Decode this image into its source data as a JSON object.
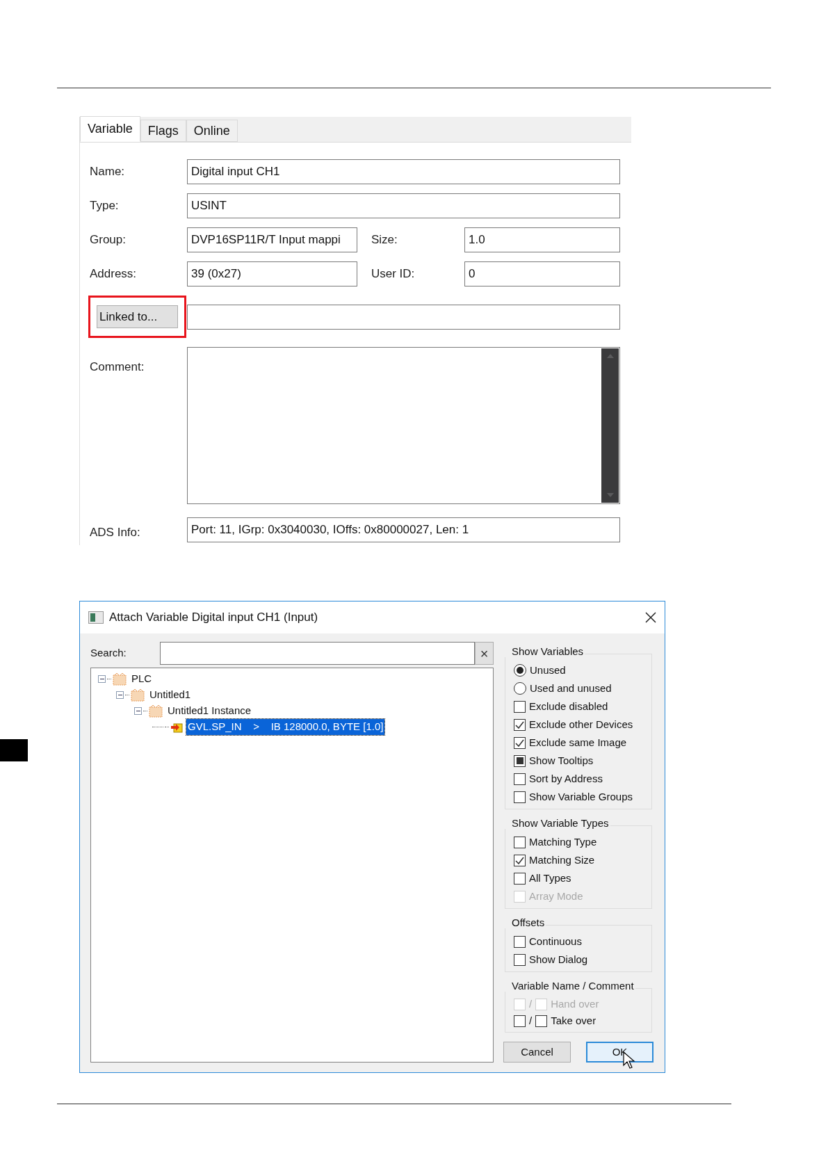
{
  "variable_panel": {
    "tabs": [
      {
        "label": "Variable",
        "selected": true
      },
      {
        "label": "Flags",
        "selected": false
      },
      {
        "label": "Online",
        "selected": false
      }
    ],
    "name": {
      "label": "Name:",
      "value": "Digital input CH1"
    },
    "type": {
      "label": "Type:",
      "value": "USINT"
    },
    "group": {
      "label": "Group:",
      "value": "DVP16SP11R/T Input mappi"
    },
    "size": {
      "label": "Size:",
      "value": "1.0"
    },
    "address": {
      "label": "Address:",
      "value": "39 (0x27)"
    },
    "user_id": {
      "label": "User ID:",
      "value": "0"
    },
    "linked_button": {
      "label": "Linked to...",
      "highlighted": true
    },
    "comment": {
      "label": "Comment:"
    },
    "ads_info": {
      "label": "ADS Info:",
      "value": "Port: 11, IGrp: 0x3040030, IOffs: 0x80000027, Len: 1"
    }
  },
  "dialog": {
    "title": "Attach Variable Digital input CH1 (Input)",
    "search": {
      "label": "Search:",
      "clear": "×"
    },
    "tree": [
      {
        "label": "PLC",
        "expanded": true,
        "children": [
          {
            "label": "Untitled1",
            "expanded": true,
            "children": [
              {
                "label": "Untitled1 Instance",
                "expanded": true,
                "children": [
                  {
                    "label": "GVL.SP_IN    >    IB 128000.0, BYTE [1.0]",
                    "selected": true
                  }
                ]
              }
            ]
          }
        ]
      }
    ],
    "groups": [
      {
        "title": "Show Variables",
        "options": [
          {
            "kind": "radio",
            "label": "Unused",
            "checked": true,
            "disabled": false
          },
          {
            "kind": "radio",
            "label": "Used and unused",
            "checked": false,
            "disabled": false
          },
          {
            "kind": "checkbox",
            "label": "Exclude disabled",
            "checked": false,
            "disabled": false
          },
          {
            "kind": "checkbox",
            "label": "Exclude other Devices",
            "checked": true,
            "disabled": false
          },
          {
            "kind": "checkbox",
            "label": "Exclude same Image",
            "checked": true,
            "disabled": false
          },
          {
            "kind": "tristate",
            "label": "Show Tooltips",
            "checked": true,
            "disabled": false
          },
          {
            "kind": "checkbox",
            "label": "Sort by Address",
            "checked": false,
            "disabled": false
          },
          {
            "kind": "checkbox",
            "label": "Show Variable Groups",
            "checked": false,
            "disabled": false
          }
        ]
      },
      {
        "title": "Show Variable Types",
        "options": [
          {
            "kind": "checkbox",
            "label": "Matching Type",
            "checked": false,
            "disabled": false
          },
          {
            "kind": "checkbox",
            "label": "Matching Size",
            "checked": true,
            "disabled": false
          },
          {
            "kind": "checkbox",
            "label": "All Types",
            "checked": false,
            "disabled": false
          },
          {
            "kind": "checkbox",
            "label": "Array Mode",
            "checked": false,
            "disabled": true
          }
        ]
      },
      {
        "title": "Offsets",
        "options": [
          {
            "kind": "checkbox",
            "label": "Continuous",
            "checked": false,
            "disabled": false
          },
          {
            "kind": "checkbox",
            "label": "Show Dialog",
            "checked": false,
            "disabled": false
          }
        ]
      },
      {
        "title": "Variable Name / Comment",
        "options": [
          {
            "kind": "pair",
            "separator": "/",
            "label": "Hand over",
            "checked_left": false,
            "checked_right": false,
            "disabled": true
          },
          {
            "kind": "pair",
            "separator": "/",
            "label": "Take over",
            "checked_left": false,
            "checked_right": false,
            "disabled": false
          }
        ]
      }
    ],
    "buttons": [
      {
        "label": "Cancel",
        "default": false
      },
      {
        "label": "OK",
        "default": true
      }
    ]
  }
}
